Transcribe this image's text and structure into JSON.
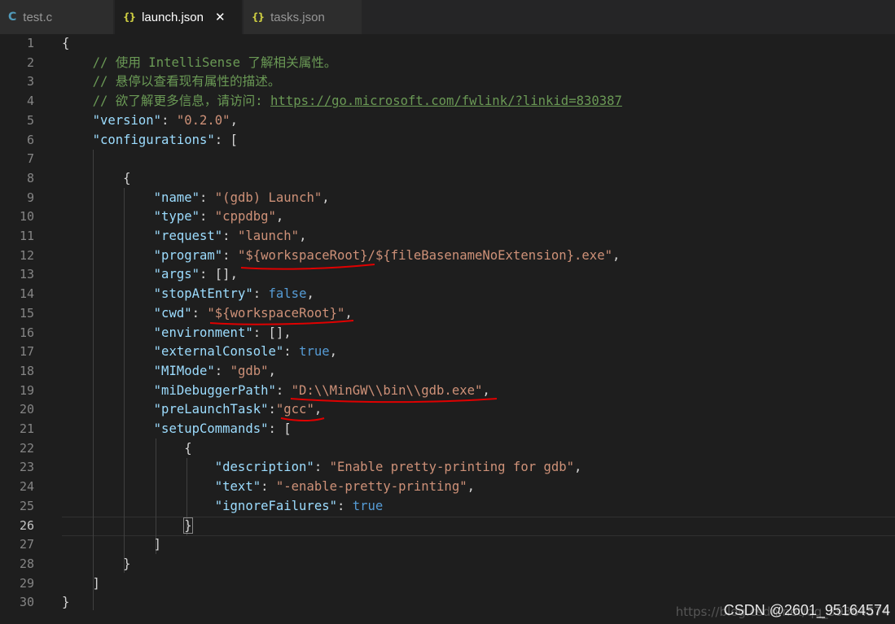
{
  "tabs": [
    {
      "icon": "C",
      "label": "test.c"
    },
    {
      "icon": "{}",
      "label": "launch.json",
      "close": "✕"
    },
    {
      "icon": "{}",
      "label": "tasks.json"
    }
  ],
  "lines": [
    {
      "n": "1",
      "t": "{"
    },
    {
      "n": "2",
      "t": "    // 使用 IntelliSense 了解相关属性。"
    },
    {
      "n": "3",
      "t": "    // 悬停以查看现有属性的描述。"
    },
    {
      "n": "4",
      "t": "    // 欲了解更多信息，请访问: https://go.microsoft.com/fwlink/?linkid=830387"
    },
    {
      "n": "5",
      "t": "    \"version\": \"0.2.0\","
    },
    {
      "n": "6",
      "t": "    \"configurations\": ["
    },
    {
      "n": "7",
      "t": ""
    },
    {
      "n": "8",
      "t": "        {"
    },
    {
      "n": "9",
      "t": "            \"name\": \"(gdb) Launch\","
    },
    {
      "n": "10",
      "t": "            \"type\": \"cppdbg\","
    },
    {
      "n": "11",
      "t": "            \"request\": \"launch\","
    },
    {
      "n": "12",
      "t": "            \"program\": \"${workspaceRoot}/${fileBasenameNoExtension}.exe\","
    },
    {
      "n": "13",
      "t": "            \"args\": [],"
    },
    {
      "n": "14",
      "t": "            \"stopAtEntry\": false,"
    },
    {
      "n": "15",
      "t": "            \"cwd\": \"${workspaceRoot}\","
    },
    {
      "n": "16",
      "t": "            \"environment\": [],"
    },
    {
      "n": "17",
      "t": "            \"externalConsole\": true,"
    },
    {
      "n": "18",
      "t": "            \"MIMode\": \"gdb\","
    },
    {
      "n": "19",
      "t": "            \"miDebuggerPath\": \"D:\\\\MinGW\\\\bin\\\\gdb.exe\","
    },
    {
      "n": "20",
      "t": "            \"preLaunchTask\":\"gcc\","
    },
    {
      "n": "21",
      "t": "            \"setupCommands\": ["
    },
    {
      "n": "22",
      "t": "                {"
    },
    {
      "n": "23",
      "t": "                    \"description\": \"Enable pretty-printing for gdb\","
    },
    {
      "n": "24",
      "t": "                    \"text\": \"-enable-pretty-printing\","
    },
    {
      "n": "25",
      "t": "                    \"ignoreFailures\": true"
    },
    {
      "n": "26",
      "t": "                }"
    },
    {
      "n": "27",
      "t": "            ]"
    },
    {
      "n": "28",
      "t": "        }"
    },
    {
      "n": "29",
      "t": "    ]"
    },
    {
      "n": "30",
      "t": "}"
    }
  ],
  "current_line": "26",
  "watermark_back": "https://blog.csdn.net/qq_39364574",
  "watermark_front": "CSDN @2601_95164574",
  "colors": {
    "comment": "#6a9955",
    "key": "#9cdcfe",
    "string": "#ce9178",
    "keyword": "#569cd6",
    "annotation": "#e00000"
  }
}
